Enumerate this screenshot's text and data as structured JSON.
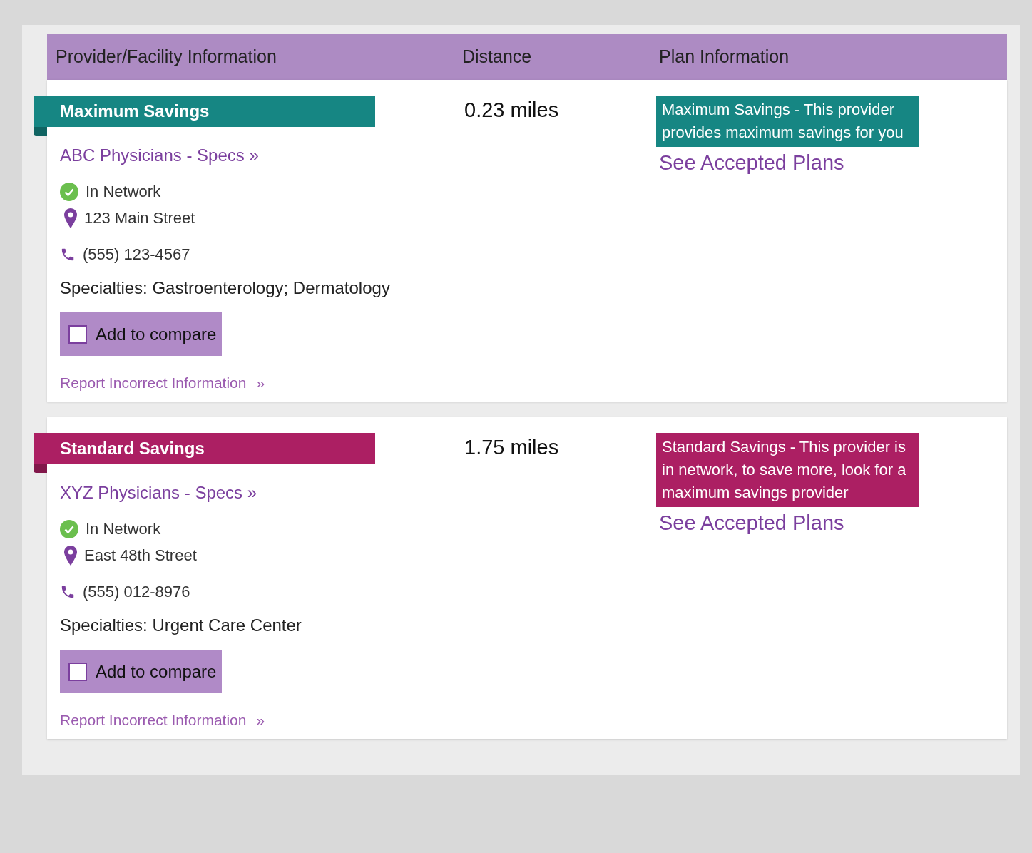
{
  "table": {
    "columns": [
      "Provider/Facility Information",
      "Distance",
      "Plan Information"
    ],
    "rows": [
      {
        "tier": "Maximum Savings",
        "color": "#168683",
        "name": "ABC Physicians - Specs »",
        "network": "In Network",
        "address": "123 Main Street",
        "phone": "(555) 123-4567",
        "specialties_label": "Specialties:",
        "specialties": "Gastroenterology; Dermatology",
        "compare": {
          "label": "Add to compare",
          "checked": false
        },
        "report": "Report Incorrect Information",
        "report_arrow": "»",
        "distance": "0.23 miles",
        "plan_note": "Maximum Savings - This provider provides maximum savings for you",
        "plans_link": "See Accepted Plans"
      },
      {
        "tier": "Standard Savings",
        "color": "#ac1f63",
        "name": "XYZ Physicians - Specs »",
        "network": "In Network",
        "address": "East 48th Street",
        "phone": "(555) 012-8976",
        "specialties_label": "Specialties:",
        "specialties": "Urgent Care Center",
        "compare": {
          "label": "Add to compare",
          "checked": false
        },
        "report": "Report Incorrect Information",
        "report_arrow": "»",
        "distance": "1.75 miles",
        "plan_note": "Standard Savings - This provider is in network, to save more, look for a maximum savings provider",
        "plans_link": "See Accepted Plans"
      }
    ]
  }
}
